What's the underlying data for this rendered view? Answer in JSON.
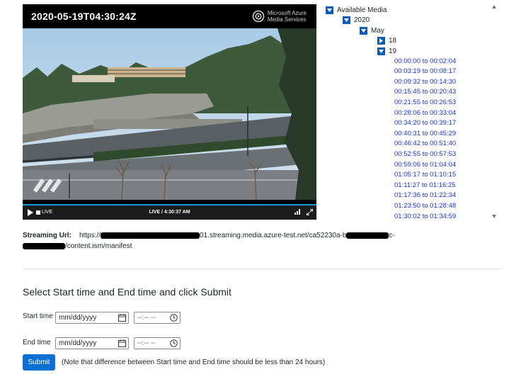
{
  "player": {
    "timestamp": "2020-05-19T04:30:24Z",
    "logo_line1": "Microsoft Azure",
    "logo_line2": "Media Services",
    "live_badge": "LIVE",
    "status_center": "LIVE / 4:30:37 AM",
    "playback_progress": 1.0,
    "accent_color": "#1a9bd7"
  },
  "tree": {
    "root": "Available Media",
    "year": "2020",
    "month": "May",
    "days": [
      "18",
      "19"
    ],
    "segments": [
      "00:00:00 to 00:02:04",
      "00:03:19 to 00:08:17",
      "00:09:32 to 00:14:30",
      "00:15:45 to 00:20:43",
      "00:21:55 to 00:26:53",
      "00:28:06 to 00:33:04",
      "00:34:20 to 00:39:17",
      "00:40:31 to 00:45:29",
      "00:46:42 to 00:51:40",
      "00:52:55 to 00:57:53",
      "00:59:06 to 01:04:04",
      "01:05:17 to 01:10:15",
      "01:11:27 to 01:16:25",
      "01:17:36 to 01:22:34",
      "01:23:50 to 01:28:48",
      "01:30:02 to 01:34:59"
    ],
    "toggle_color": "#0d5bb4",
    "link_color": "#1a33d1"
  },
  "streaming": {
    "label": "Streaming Url:",
    "url_prefix": "https://",
    "url_mid": "01.streaming.media.azure-test.net/ca52230a-b",
    "url_tail1": "c-",
    "url_line2_end": "/content.ism/manifest"
  },
  "form": {
    "heading": "Select Start time and End time and click Submit",
    "start_label": "Start time",
    "end_label": "End time",
    "date_placeholder": "mm/dd/yyyy",
    "time_placeholder": "--:-- --",
    "submit_label": "Submit",
    "note": "(Note that difference between Start time and End time should be less than 24 hours)",
    "submit_color": "#0b6fd3"
  }
}
